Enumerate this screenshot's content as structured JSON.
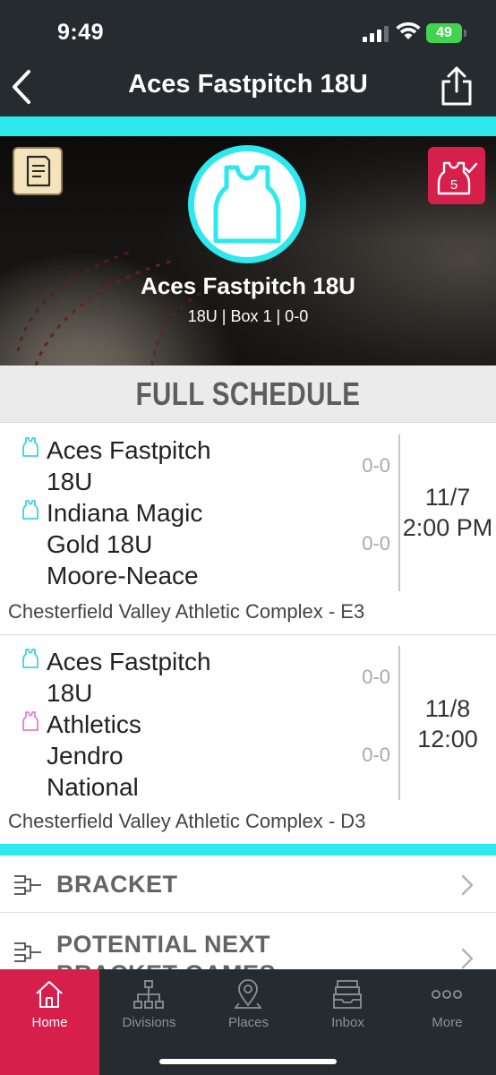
{
  "status_bar": {
    "time": "9:49",
    "battery": "49"
  },
  "nav": {
    "title": "Aces Fastpitch 18U"
  },
  "team_header": {
    "name": "Aces Fastpitch 18U",
    "details": "18U | Box 1 | 0-0",
    "badge_number": "5"
  },
  "schedule": {
    "heading": "FULL SCHEDULE",
    "games": [
      {
        "team1": {
          "name_line1": "Aces Fastpitch",
          "name_line2": "18U",
          "score": "0-0",
          "jersey_color": "#3fd2e0"
        },
        "team2": {
          "name_line1": "Indiana Magic",
          "name_line2": "Gold 18U",
          "name_line3": "Moore-Neace",
          "score": "0-0",
          "jersey_color": "#3fd2e0"
        },
        "date": "11/7",
        "time": "2:00 PM",
        "venue": "Chesterfield Valley Athletic Complex - E3"
      },
      {
        "team1": {
          "name_line1": "Aces Fastpitch",
          "name_line2": "18U",
          "score": "0-0",
          "jersey_color": "#3fd2e0"
        },
        "team2": {
          "name_line1": "Athletics",
          "name_line2": "Jendro",
          "name_line3": "National",
          "score": "0-0",
          "jersey_color": "#e27fd5"
        },
        "date": "11/8",
        "time": "12:00",
        "venue": "Chesterfield Valley Athletic Complex - D3"
      }
    ]
  },
  "links": {
    "bracket": "BRACKET",
    "potential_line1": "POTENTIAL NEXT",
    "potential_line2": "BRACKET GAMES"
  },
  "tabs": [
    {
      "label": "Home",
      "icon": "home-icon",
      "active": true
    },
    {
      "label": "Divisions",
      "icon": "divisions-icon"
    },
    {
      "label": "Places",
      "icon": "location-pin-icon"
    },
    {
      "label": "Inbox",
      "icon": "inbox-icon"
    },
    {
      "label": "More",
      "icon": "more-dots-icon"
    }
  ],
  "colors": {
    "accent": "#2de8ec",
    "brand": "#d71f4b",
    "dark": "#262b2f"
  }
}
